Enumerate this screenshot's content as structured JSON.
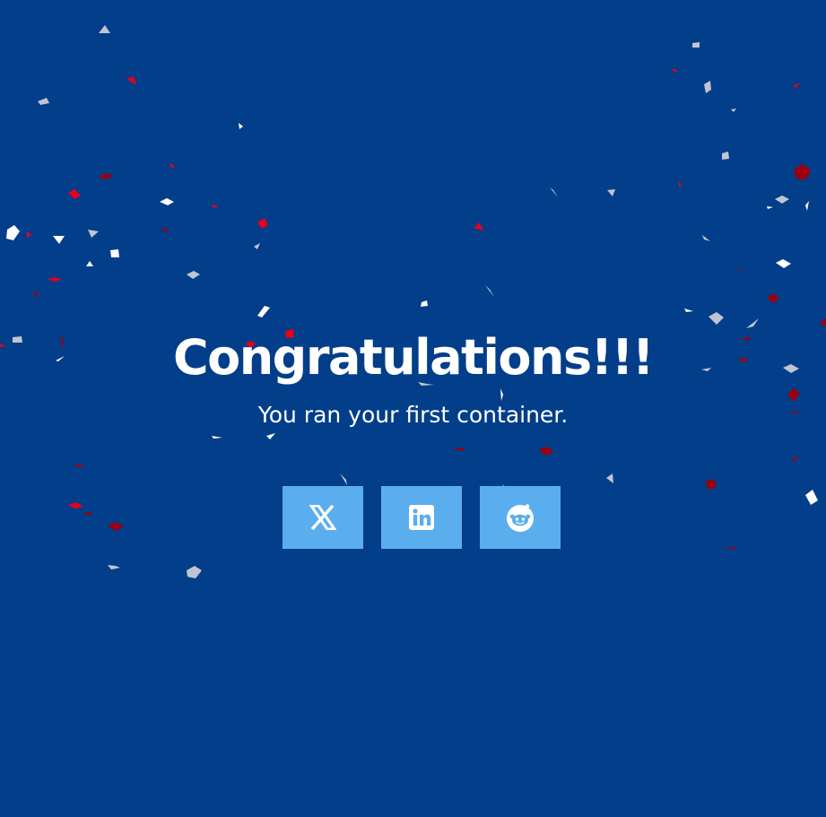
{
  "hero": {
    "title": "Congratulations!!!",
    "subtitle": "You ran your first container."
  },
  "share": {
    "buttons": [
      {
        "icon": "x-twitter-icon",
        "name": "X"
      },
      {
        "icon": "linkedin-icon",
        "name": "LinkedIn"
      },
      {
        "icon": "reddit-icon",
        "name": "Reddit"
      }
    ]
  },
  "colors": {
    "background": "#023e8a",
    "button": "#5aaeee",
    "text": "#ffffff",
    "confetti": [
      "#ffffff",
      "#c0c5cf",
      "#e8001c",
      "#9a0010"
    ]
  }
}
